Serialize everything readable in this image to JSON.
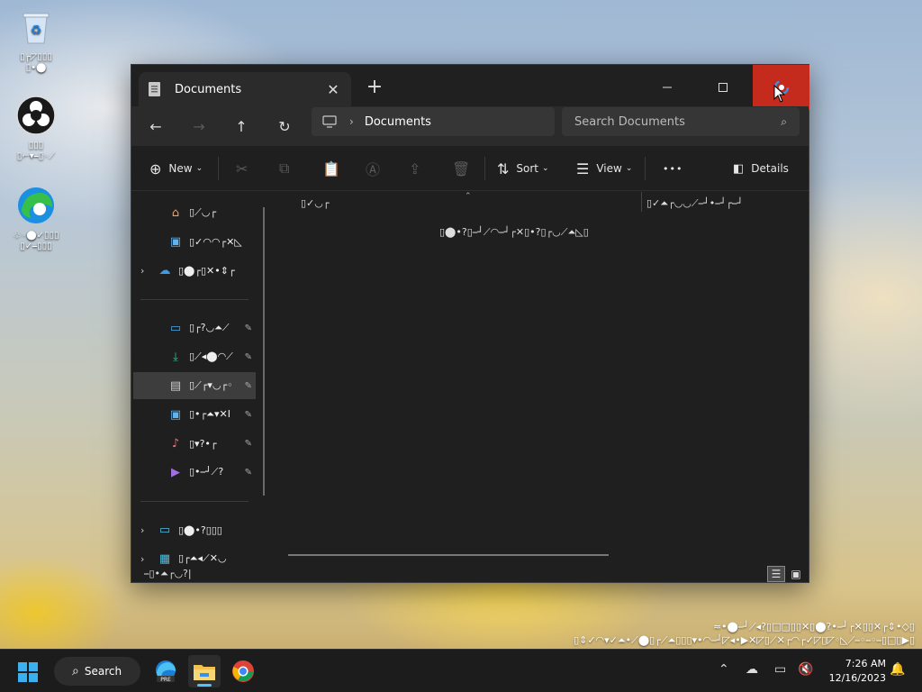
{
  "desktop": {
    "icons": [
      {
        "name": "recycle-bin",
        "label": "▯┌◸▯▯▯\n▯•⬤"
      },
      {
        "name": "obs",
        "label": "▯▯▯\n▯⌐▾⎯▯◦⟋"
      },
      {
        "name": "edge",
        "label": "♧◦⬤✓▯▯▯\n▯✓⎯▯▯▯"
      }
    ]
  },
  "window": {
    "tab_title": "Documents",
    "tab_close": "✕",
    "new_tab": "+",
    "address": {
      "path": "Documents"
    },
    "search": {
      "placeholder": "Search Documents"
    },
    "toolbar": {
      "new_label": "New",
      "sort_label": "Sort",
      "view_label": "View",
      "more_label": "•••",
      "details_label": "Details"
    },
    "nav_pane": {
      "items": [
        {
          "label": "▯⟋◡┌"
        },
        {
          "label": "▯✓◠◠┌✕◺"
        },
        {
          "label": "▯⬤┌▯✕•⇕┌"
        },
        {
          "label": "▯┌?◡⏶⟋"
        },
        {
          "label": "▯⟋◂⬤◠⟋"
        },
        {
          "label": "▯⟋┌▾◡┌◦"
        },
        {
          "label": "▯•┌⏶▾✕I"
        },
        {
          "label": "▯▾?•┌"
        },
        {
          "label": "▯•⎯┘⟋?"
        },
        {
          "label": "▯⬤•?▯▯▯"
        },
        {
          "label": "▯┌⏶◂⟋✕◡"
        }
      ]
    },
    "content": {
      "col_name": "▯✓◡┌",
      "col_date": "▯✓⏶┌◡◡⟋⎯┘•⎯┘┌⎯┘",
      "empty_message": "▯⬤•?▯⎯┘⟋◠⎯┘┌✕▯•?▯┌◡⟋⏶◺▯"
    },
    "status": {
      "items": "⎯▯•⏶┌◡?|"
    }
  },
  "watermark": {
    "line1": "≈•⬤⎯┘⟋◂?▯□□▯▯✕▯⬤?•⎯┘┌✕▯▯✕┌⇕•◇▯",
    "line2": "▯⇕✓◠▾✓⏶•⟋⬤▯┌⟋⏶▯▯▯▾•◠⎯┘◸◂•▶✕◸▯⟋✕┌◠┌✓◸▯◸◦◺⟋⎯◦⎯◦⎯▯□▯▶▯"
  },
  "taskbar": {
    "search_label": "Search",
    "time": "7:26 AM",
    "date": "12/16/2023"
  }
}
